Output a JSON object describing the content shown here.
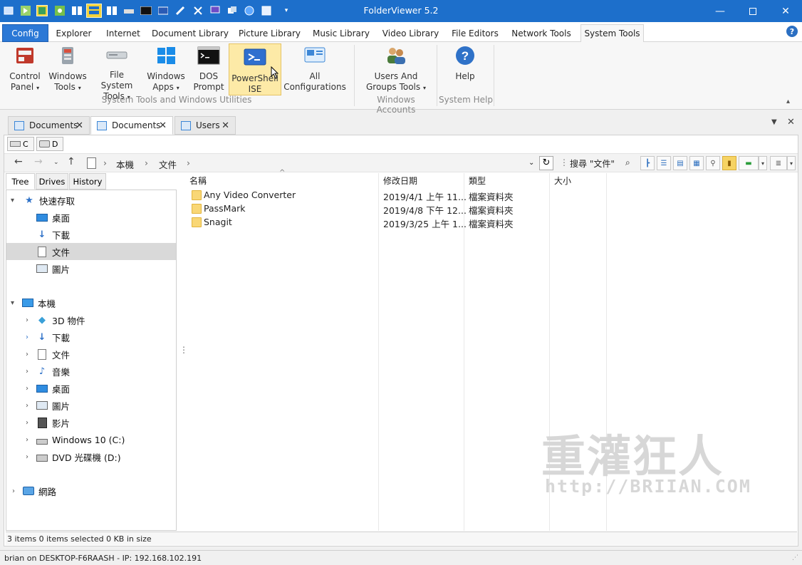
{
  "window": {
    "title": "FolderViewer 5.2",
    "accent": "#1d6fcb"
  },
  "ribbon_tabs": [
    "Config",
    "Explorer",
    "Internet",
    "Document Library",
    "Picture Library",
    "Music Library",
    "Video Library",
    "File Editors",
    "Network Tools",
    "System Tools"
  ],
  "ribbon_groups": [
    {
      "label": "System Tools and Windows Utilities",
      "buttons": [
        {
          "line1": "Control",
          "line2": "Panel",
          "dropdown": true
        },
        {
          "line1": "Windows",
          "line2": "Tools",
          "dropdown": true
        },
        {
          "line1": "File System",
          "line2": "Tools",
          "dropdown": true
        },
        {
          "line1": "Windows",
          "line2": "Apps",
          "dropdown": true
        },
        {
          "line1": "DOS",
          "line2": "Prompt",
          "dropdown": false
        },
        {
          "line1": "PowerShell",
          "line2": "ISE",
          "dropdown": false
        },
        {
          "line1": "All",
          "line2": "Configurations",
          "dropdown": false
        }
      ]
    },
    {
      "label": "Windows Accounts",
      "buttons": [
        {
          "line1": "Users And",
          "line2": "Groups Tools",
          "dropdown": true
        }
      ]
    },
    {
      "label": "System Help",
      "buttons": [
        {
          "line1": "Help",
          "line2": "",
          "dropdown": false
        }
      ]
    }
  ],
  "document_tabs": [
    "Documents",
    "Documents",
    "Users"
  ],
  "drives": [
    "C",
    "D"
  ],
  "breadcrumb": [
    "本機",
    "文件"
  ],
  "search": {
    "placeholder": "搜尋 \"文件\""
  },
  "left_tabs": [
    "Tree",
    "Drives",
    "History"
  ],
  "tree": {
    "quick_access": {
      "label": "快速存取",
      "items": [
        "桌面",
        "下載",
        "文件",
        "圖片"
      ]
    },
    "this_pc": {
      "label": "本機",
      "items": [
        "3D 物件",
        "下載",
        "文件",
        "音樂",
        "桌面",
        "圖片",
        "影片",
        "Windows 10 (C:)",
        "DVD 光碟機 (D:)"
      ]
    },
    "network": {
      "label": "網路"
    }
  },
  "columns": [
    "名稱",
    "修改日期",
    "類型",
    "大小"
  ],
  "files": [
    {
      "name": "Any Video Converter",
      "modified": "2019/4/1 上午 11...",
      "type": "檔案資料夾"
    },
    {
      "name": "PassMark",
      "modified": "2019/4/8 下午 12...",
      "type": "檔案資料夾"
    },
    {
      "name": "Snagit",
      "modified": "2019/3/25 上午 1...",
      "type": "檔案資料夾"
    }
  ],
  "status": {
    "summary": "3 items  0 items selected 0 KB in size",
    "user": "brian on DESKTOP-F6RAASH - IP: 192.168.102.191"
  },
  "watermark": {
    "title": "重灌狂人",
    "url": "http://BRIIAN.COM"
  }
}
